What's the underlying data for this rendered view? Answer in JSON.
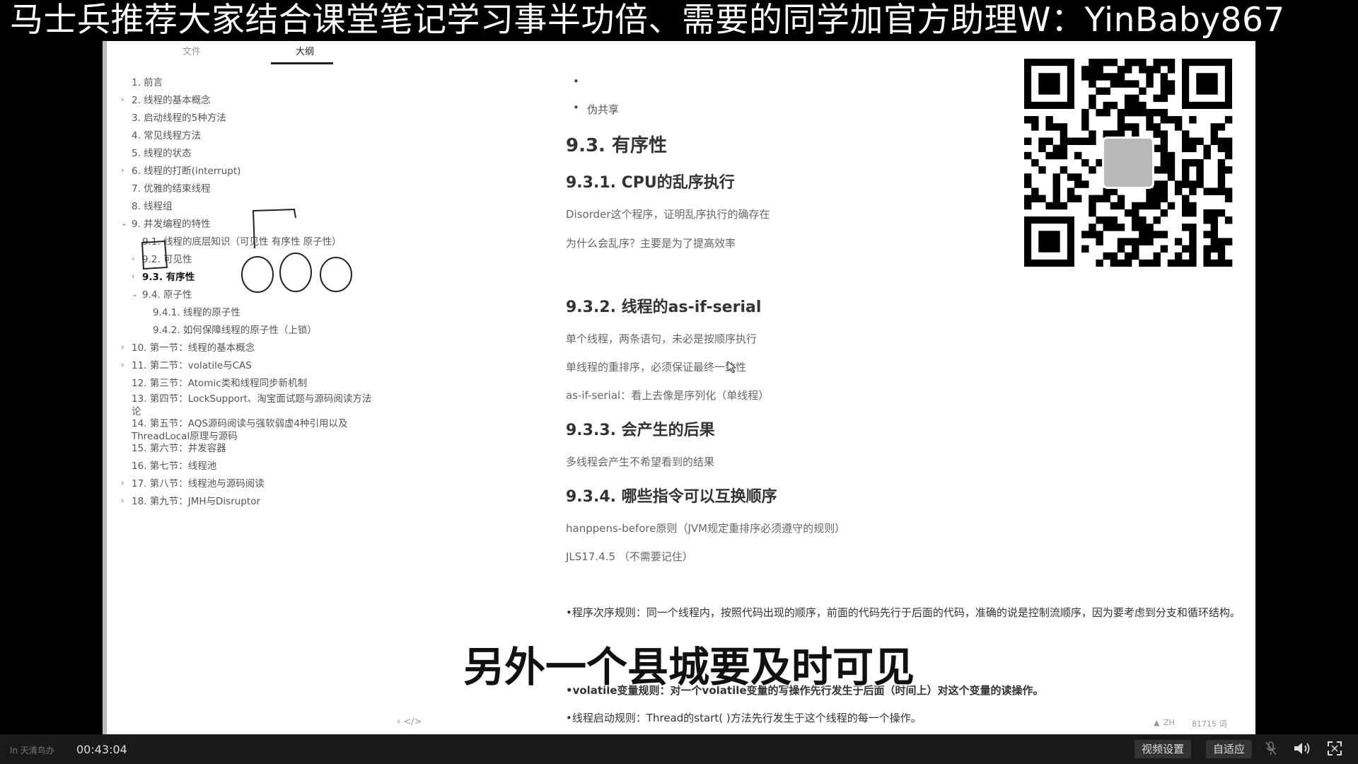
{
  "banner": {
    "text": "马士兵推荐大家结合课堂笔记学习事半功倍、需要的同学加官方助理W：YinBaby867"
  },
  "sidebar": {
    "tabs": {
      "file": "文件",
      "outline": "大纲"
    },
    "items": [
      {
        "label": "1. 前言",
        "arrow": ""
      },
      {
        "label": "2. 线程的基本概念",
        "arrow": "›"
      },
      {
        "label": "3. 启动线程的5种方法",
        "arrow": ""
      },
      {
        "label": "4. 常见线程方法",
        "arrow": ""
      },
      {
        "label": "5. 线程的状态",
        "arrow": ""
      },
      {
        "label": "6. 线程的打断(interrupt)",
        "arrow": "›"
      },
      {
        "label": "7. 优雅的结束线程",
        "arrow": ""
      },
      {
        "label": "8. 线程组",
        "arrow": ""
      },
      {
        "label": "9. 并发编程的特性",
        "arrow": "⌄"
      },
      {
        "label": "9.1. 线程的底层知识（可见性 有序性 原子性）",
        "arrow": ""
      },
      {
        "label": "9.2. 可见性",
        "arrow": "›"
      },
      {
        "label": "9.3. 有序性",
        "arrow": "›"
      },
      {
        "label": "9.4. 原子性",
        "arrow": "⌄"
      },
      {
        "label": "9.4.1. 线程的原子性",
        "arrow": ""
      },
      {
        "label": "9.4.2. 如何保障线程的原子性（上锁）",
        "arrow": ""
      },
      {
        "label": "10. 第一节：线程的基本概念",
        "arrow": "›"
      },
      {
        "label": "11. 第二节：volatile与CAS",
        "arrow": "›"
      },
      {
        "label": "12. 第三节：Atomic类和线程同步新机制",
        "arrow": ""
      },
      {
        "label": "13. 第四节：LockSupport、淘宝面试题与源码阅读方法论",
        "arrow": ""
      },
      {
        "label": "14. 第五节：AQS源码阅读与强软弱虚4种引用以及ThreadLocal原理与源码",
        "arrow": ""
      },
      {
        "label": "15. 第六节：并发容器",
        "arrow": ""
      },
      {
        "label": "16. 第七节：线程池",
        "arrow": ""
      },
      {
        "label": "17. 第八节：线程池与源码阅读",
        "arrow": "›"
      },
      {
        "label": "18. 第九节：JMH与Disruptor",
        "arrow": "›"
      }
    ]
  },
  "content": {
    "bullet_false_sharing": "伪共享",
    "h_ordering": "9.3. 有序性",
    "h_cpu": "9.3.1. CPU的乱序执行",
    "p_disorder": "Disorder这个程序，证明乱序执行的确存在",
    "p_why": "为什么会乱序？主要是为了提高效率",
    "h_asif": "9.3.2. 线程的as-if-serial",
    "p_single1": "单个线程，两条语句，未必是按顺序执行",
    "p_single2": "单线程的重排序，必须保证最终一致性",
    "p_asif": "as-if-serial：看上去像是序列化（单线程）",
    "h_result": "9.3.3. 会产生的后果",
    "p_result": "多线程会产生不希望看到的结果",
    "h_swap": "9.3.4. 哪些指令可以互换顺序",
    "p_hb": "hanppens-before原则（JVM规定重排序必须遵守的规则）",
    "p_jls": "JLS17.4.5 （不需要记住）",
    "p_rule1": "•程序次序规则：同一个线程内，按照代码出现的顺序，前面的代码先行于后面的代码，准确的说是控制流顺序，因为要考虑到分支和循环结构。",
    "p_rule_volatile": "•volatile变量规则：对一个volatile变量的写操作先行发生于后面（时间上）对这个变量的读操作。",
    "p_rule_start": "•线程启动规则：Thread的start( )方法先行发生于这个线程的每一个操作。"
  },
  "subtitle": "另外一个县城要及时可见",
  "doc_status": {
    "nav": "‹   </>",
    "lang": "ZH",
    "words": "81715 词"
  },
  "player": {
    "left_label": "ln 天清鸟办",
    "time": "00:43:04",
    "btn_video_settings": "视频设置",
    "btn_fit": "自适应",
    "icon_mic": "mic-icon",
    "icon_volume": "volume-icon",
    "icon_fullscreen": "fullscreen-icon"
  }
}
